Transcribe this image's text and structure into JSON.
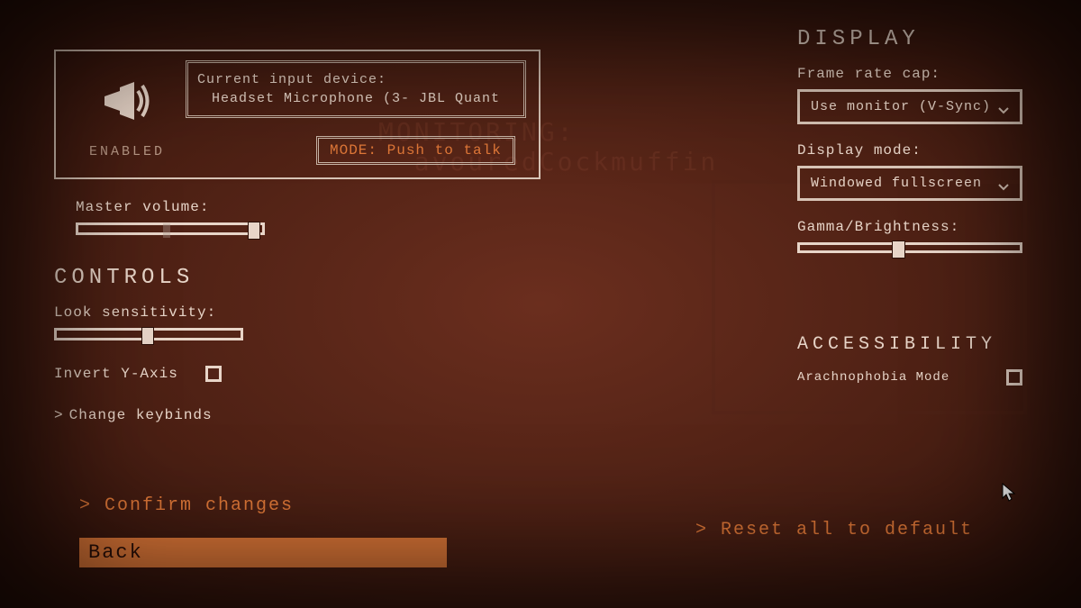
{
  "voice": {
    "status": "ENABLED",
    "device_label": "Current input device:",
    "device_value": "Headset Microphone (3- JBL Quant",
    "mode_prefix": "MODE:",
    "mode_value": "Push to talk"
  },
  "audio": {
    "master_volume_label": "Master volume:",
    "master_volume_pct": 92,
    "master_volume_ghost_pct": 46
  },
  "controls": {
    "heading": "CONTROLS",
    "look_sens_label": "Look sensitivity:",
    "look_sens_pct": 46,
    "invert_y_label": "Invert Y-Axis",
    "invert_y_checked": false,
    "change_keybinds": "Change keybinds"
  },
  "display": {
    "heading": "DISPLAY",
    "frame_cap_label": "Frame rate cap:",
    "frame_cap_value": "Use monitor (V-Sync)",
    "mode_label": "Display mode:",
    "mode_value": "Windowed fullscreen",
    "gamma_label": "Gamma/Brightness:",
    "gamma_pct": 42
  },
  "accessibility": {
    "heading": "ACCESSIBILITY",
    "arachnophobia_label": "Arachnophobia Mode",
    "arachnophobia_checked": false
  },
  "bottom": {
    "confirm": "Confirm changes",
    "back": "Back",
    "reset": "Reset all to default"
  },
  "bg_ghost": "MONITORING:\n  avouredCockmuffin",
  "colors": {
    "accent": "#e07838",
    "text": "#e8d5c8"
  }
}
